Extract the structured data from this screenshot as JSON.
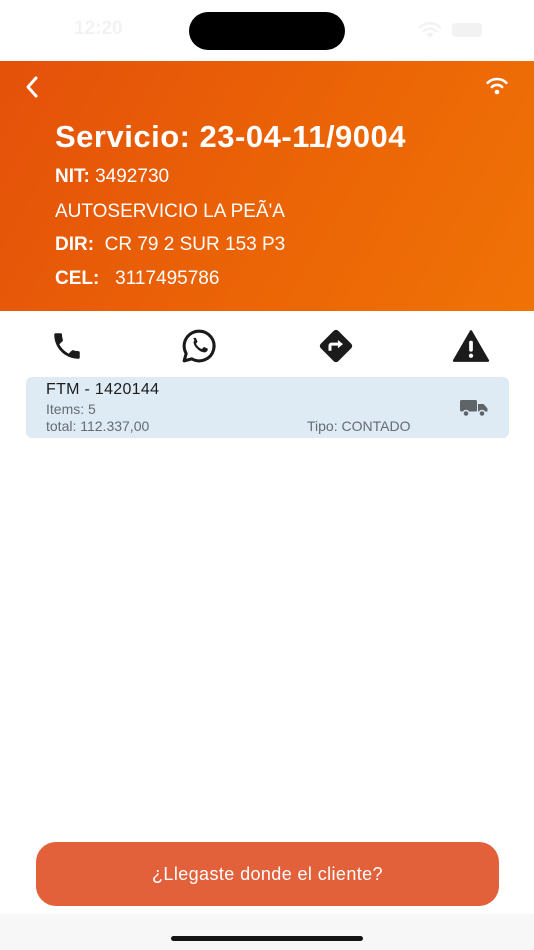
{
  "status_bar": {
    "time": "12:20"
  },
  "header": {
    "back_icon": "chevron-left-icon",
    "connection_icon": "wifi-icon",
    "title": "Servicio: 23-04-11/9004",
    "nit_label": "NIT:",
    "nit_value": "3492730",
    "client_name": "AUTOSERVICIO LA PEÃ'A",
    "dir_label": "DIR:",
    "dir_value": "CR 79 2 SUR 153 P3",
    "cel_label": "CEL:",
    "cel_value": "3117495786"
  },
  "actions": [
    {
      "icon": "phone-icon"
    },
    {
      "icon": "whatsapp-icon"
    },
    {
      "icon": "directions-icon"
    },
    {
      "icon": "warning-icon"
    }
  ],
  "order": {
    "id": "FTM - 1420144",
    "items": "Items: 5",
    "total": "total:  112.337,00",
    "tipo": "Tipo: CONTADO",
    "icon": "truck-icon"
  },
  "cta_label": "¿Llegaste donde el cliente?",
  "colors": {
    "header_gradient_start": "#e4510a",
    "header_gradient_end": "#f07306",
    "card_background": "#deebf5",
    "cta_background": "#e2603a"
  }
}
